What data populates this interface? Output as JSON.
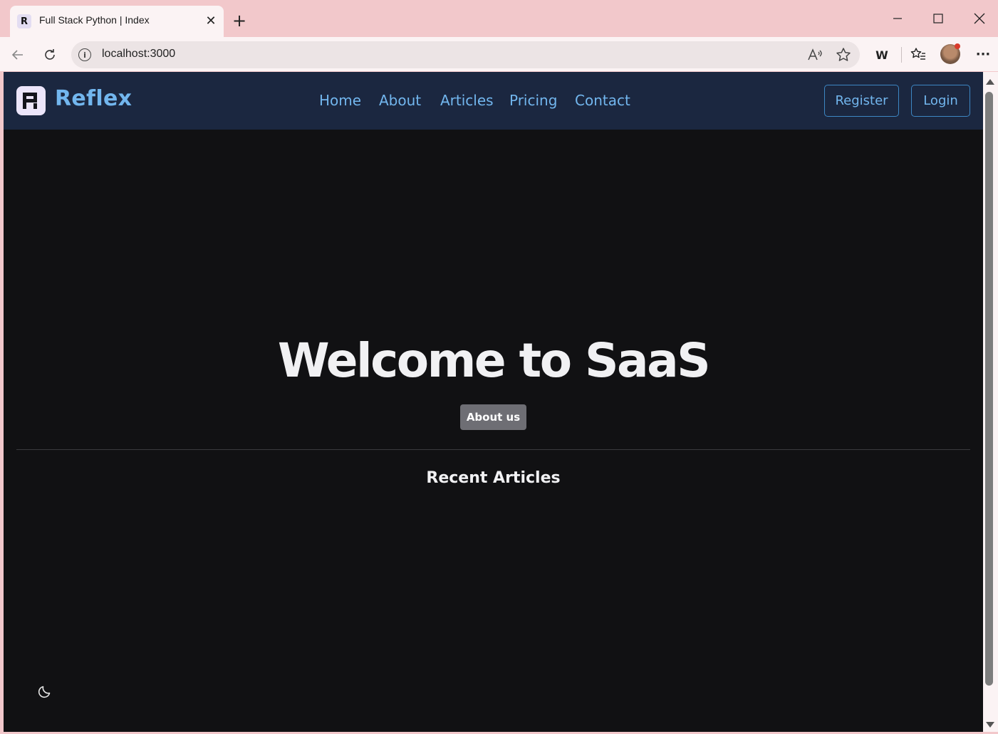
{
  "browser": {
    "tab_title": "Full Stack Python | Index",
    "tab_favicon": "R",
    "url": "localhost:3000",
    "new_tab_icon": "plus-icon",
    "profile_icon": "avatar",
    "extension_label": "W"
  },
  "site": {
    "brand": "Reflex",
    "nav": {
      "links": [
        "Home",
        "About",
        "Articles",
        "Pricing",
        "Contact"
      ],
      "register_label": "Register",
      "login_label": "Login"
    },
    "hero": {
      "title": "Welcome to SaaS",
      "cta_label": "About us"
    },
    "articles": {
      "title": "Recent Articles"
    },
    "theme_toggle_icon": "moon-icon"
  },
  "colors": {
    "navbar_bg": "#1b2740",
    "link": "#72b6ee",
    "page_bg": "#111113",
    "chrome_bg": "#f2c8cb"
  }
}
